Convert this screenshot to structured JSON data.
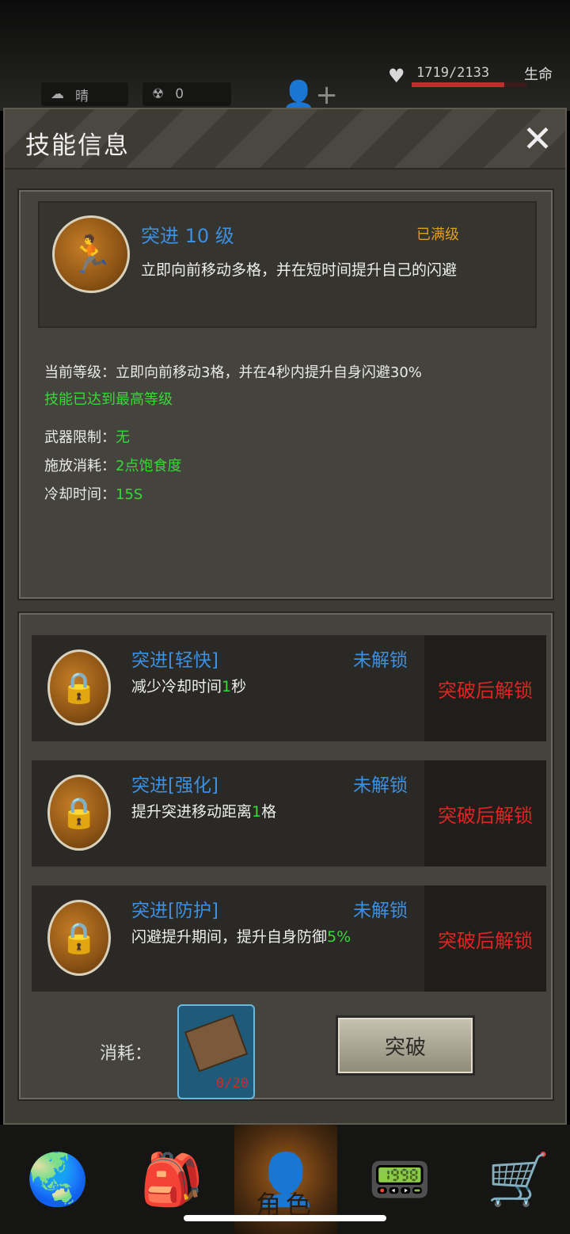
{
  "status_bar": {
    "weather": "晴",
    "radiation": "0",
    "hp": "1719/2133",
    "hp_label": "生命",
    "hp_fraction": 0.806
  },
  "dialog": {
    "title": "技能信息",
    "close_icon": "close-icon"
  },
  "skill": {
    "name": "突进 10 级",
    "maxed_label": "已满级",
    "description": "立即向前移动多格，并在短时间提升自己的闪避",
    "current_level_label": "当前等级：",
    "current_level_text": "立即向前移动3格，并在4秒内提升自身闪避30%",
    "max_notice": "技能已达到最高等级",
    "weapon_label": "武器限制：",
    "weapon_value": "无",
    "cost_label": "施放消耗：",
    "cost_value": "2点饱食度",
    "cooldown_label": "冷却时间：",
    "cooldown_value": "15S"
  },
  "upgrades": [
    {
      "title": "突进[轻快]",
      "status": "未解锁",
      "desc_prefix": "减少冷却时间",
      "desc_value": "1",
      "desc_suffix": "秒",
      "lock": "突破后解锁",
      "icon": "hourglass-lock-icon"
    },
    {
      "title": "突进[强化]",
      "status": "未解锁",
      "desc_prefix": "提升突进移动距离",
      "desc_value": "1",
      "desc_suffix": "格",
      "lock": "突破后解锁",
      "icon": "lightning-lock-icon"
    },
    {
      "title": "突进[防护]",
      "status": "未解锁",
      "desc_prefix": "闪避提升期间，提升自身防御",
      "desc_value": "5%",
      "desc_suffix": "",
      "lock": "突破后解锁",
      "icon": "shield-lock-icon"
    }
  ],
  "footer": {
    "consume_label": "消耗：",
    "item_count": "0/20",
    "break_button": "突破"
  },
  "nav": {
    "items": [
      "globe-icon",
      "backpack-icon",
      "character-icon",
      "walkie-talkie-icon",
      "cart-icon"
    ],
    "active_label": "角色"
  },
  "colors": {
    "accent_blue": "#3d8fe0",
    "highlight_green": "#39d839",
    "lock_red": "#e02424",
    "maxed_orange": "#e0a020"
  }
}
